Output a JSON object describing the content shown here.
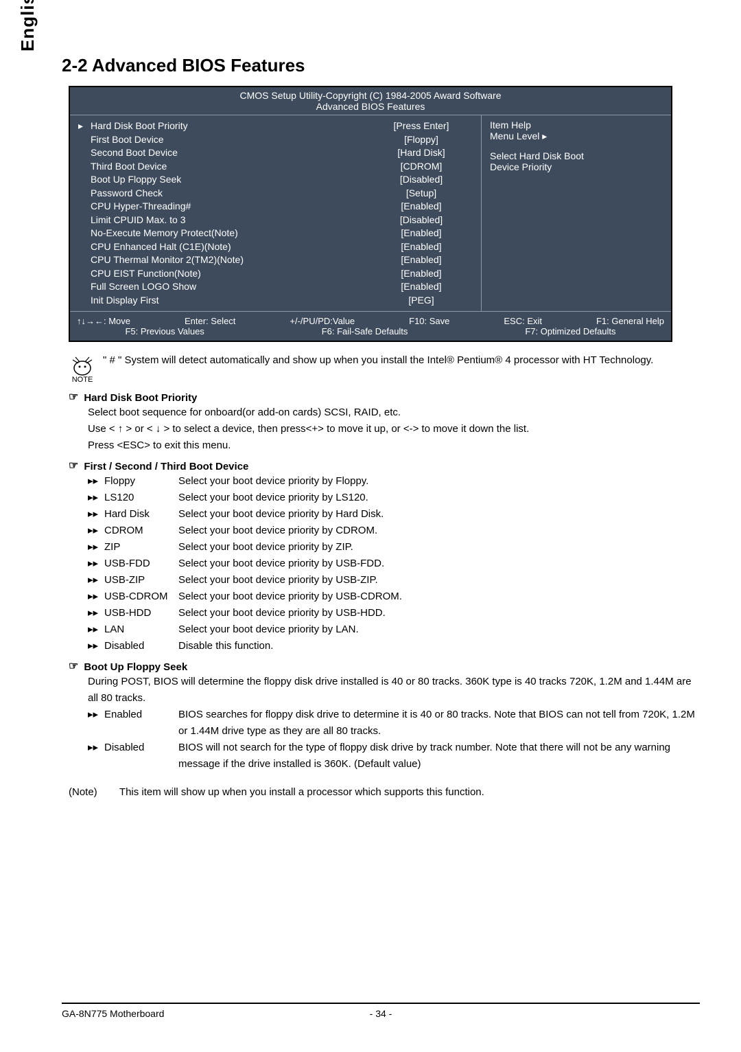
{
  "lang": "English",
  "section_title": "2-2    Advanced BIOS Features",
  "bios": {
    "header1": "CMOS Setup Utility-Copyright (C) 1984-2005 Award Software",
    "header2": "Advanced BIOS Features",
    "rows": [
      {
        "ptr": "▸",
        "label": "Hard Disk Boot Priority",
        "val": "[Press Enter]"
      },
      {
        "ptr": "",
        "label": "First Boot Device",
        "val": "[Floppy]"
      },
      {
        "ptr": "",
        "label": "Second Boot Device",
        "val": "[Hard Disk]"
      },
      {
        "ptr": "",
        "label": "Third Boot Device",
        "val": "[CDROM]"
      },
      {
        "ptr": "",
        "label": "Boot Up Floppy Seek",
        "val": "[Disabled]"
      },
      {
        "ptr": "",
        "label": "Password Check",
        "val": "[Setup]"
      },
      {
        "ptr": "",
        "label": "CPU Hyper-Threading#",
        "val": "[Enabled]"
      },
      {
        "ptr": "",
        "label": "Limit CPUID Max. to 3",
        "val": "[Disabled]"
      },
      {
        "ptr": "",
        "label": "No-Execute Memory Protect(Note)",
        "val": "[Enabled]"
      },
      {
        "ptr": "",
        "label": "CPU Enhanced Halt (C1E)(Note)",
        "val": "[Enabled]"
      },
      {
        "ptr": "",
        "label": "CPU Thermal Monitor 2(TM2)(Note)",
        "val": "[Enabled]"
      },
      {
        "ptr": "",
        "label": "CPU EIST Function(Note)",
        "val": "[Enabled]"
      },
      {
        "ptr": "",
        "label": "Full Screen LOGO Show",
        "val": "[Enabled]"
      },
      {
        "ptr": "",
        "label": "Init Display First",
        "val": "[PEG]"
      }
    ],
    "help_title": "Item Help",
    "help_menu": "Menu Level ▸",
    "help_text1": "Select Hard Disk Boot",
    "help_text2": "Device Priority",
    "footer": {
      "move": "↑↓→←: Move",
      "select": "Enter: Select",
      "value": "+/-/PU/PD:Value",
      "save": "F10: Save",
      "exit": "ESC: Exit",
      "help": "F1: General Help",
      "prev": "F5: Previous Values",
      "failsafe": "F6: Fail-Safe Defaults",
      "opt": "F7: Optimized Defaults"
    }
  },
  "note_label": "NOTE",
  "note_text": "\" # \" System will detect automatically and show up when you install the Intel® Pentium® 4 processor with HT Technology.",
  "sections": [
    {
      "heading": "Hard Disk Boot Priority",
      "body_lines": [
        "Select boot sequence for onboard(or add-on cards) SCSI, RAID, etc.",
        "Use < ↑ > or < ↓ > to select a device, then press<+> to move it up, or <-> to move it down the list.",
        "Press <ESC> to exit this menu."
      ]
    },
    {
      "heading": "First / Second / Third Boot Device",
      "options": [
        {
          "name": "Floppy",
          "desc": "Select your boot device priority by Floppy."
        },
        {
          "name": "LS120",
          "desc": "Select your boot device priority by LS120."
        },
        {
          "name": "Hard Disk",
          "desc": "Select your boot device priority by Hard Disk."
        },
        {
          "name": "CDROM",
          "desc": "Select your boot device priority by CDROM."
        },
        {
          "name": "ZIP",
          "desc": "Select your boot device priority by ZIP."
        },
        {
          "name": "USB-FDD",
          "desc": "Select your boot device priority by USB-FDD."
        },
        {
          "name": "USB-ZIP",
          "desc": "Select your boot device priority by USB-ZIP."
        },
        {
          "name": "USB-CDROM",
          "desc": "Select your boot device priority by USB-CDROM."
        },
        {
          "name": "USB-HDD",
          "desc": "Select your boot device priority by USB-HDD."
        },
        {
          "name": "LAN",
          "desc": "Select your boot device priority by LAN."
        },
        {
          "name": "Disabled",
          "desc": "Disable this function."
        }
      ]
    },
    {
      "heading": "Boot Up Floppy Seek",
      "body_lines": [
        "During POST, BIOS will determine the floppy disk drive installed is 40 or 80 tracks. 360K type is 40 tracks 720K, 1.2M and 1.44M are all 80 tracks."
      ],
      "options": [
        {
          "name": "Enabled",
          "desc": "BIOS searches for floppy disk drive to determine it is 40 or 80 tracks. Note that BIOS can not tell from 720K, 1.2M or 1.44M drive type as they are all 80 tracks."
        },
        {
          "name": "Disabled",
          "desc": "BIOS will not search for the type of floppy disk drive by track number. Note that there will not be any warning message if the drive installed is 360K. (Default value)"
        }
      ]
    }
  ],
  "footnote_label": "(Note)",
  "footnote_text": "This item will show up when you install a processor which supports this function.",
  "footer_left": "GA-8N775 Motherboard",
  "footer_center": "- 34 -"
}
